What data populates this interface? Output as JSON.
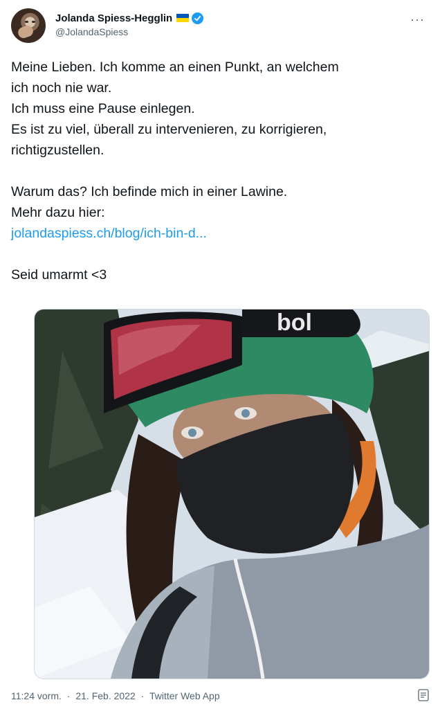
{
  "author": {
    "display_name": "Jolanda Spiess-Hegglin",
    "handle": "@JolandaSpiess",
    "flag_colors": [
      "#0057b7",
      "#ffd700"
    ],
    "verified_color": "#1d9bf0"
  },
  "more_label": "···",
  "tweet": {
    "lines_block1": [
      "Meine Lieben. Ich komme an einen Punkt, an welchem",
      "ich noch nie war.",
      "Ich muss eine Pause einlegen.",
      "Es ist zu viel, überall zu intervenieren, zu korrigieren,",
      "richtigzustellen."
    ],
    "lines_block2": [
      "Warum das? Ich befinde mich in einer Lawine.",
      "Mehr dazu hier:"
    ],
    "link": "jolandaspiess.ch/blog/ich-bin-d...",
    "closing": "Seid umarmt <3"
  },
  "photo": {
    "helmet_brand": "bol",
    "description_icon": "selfie-photo"
  },
  "meta": {
    "time": "11:24 vorm.",
    "separator": "·",
    "date": "21. Feb. 2022",
    "source": "Twitter Web App"
  },
  "colors": {
    "link": "#1d9bf0",
    "text": "#0f1419",
    "secondary": "#536471"
  }
}
